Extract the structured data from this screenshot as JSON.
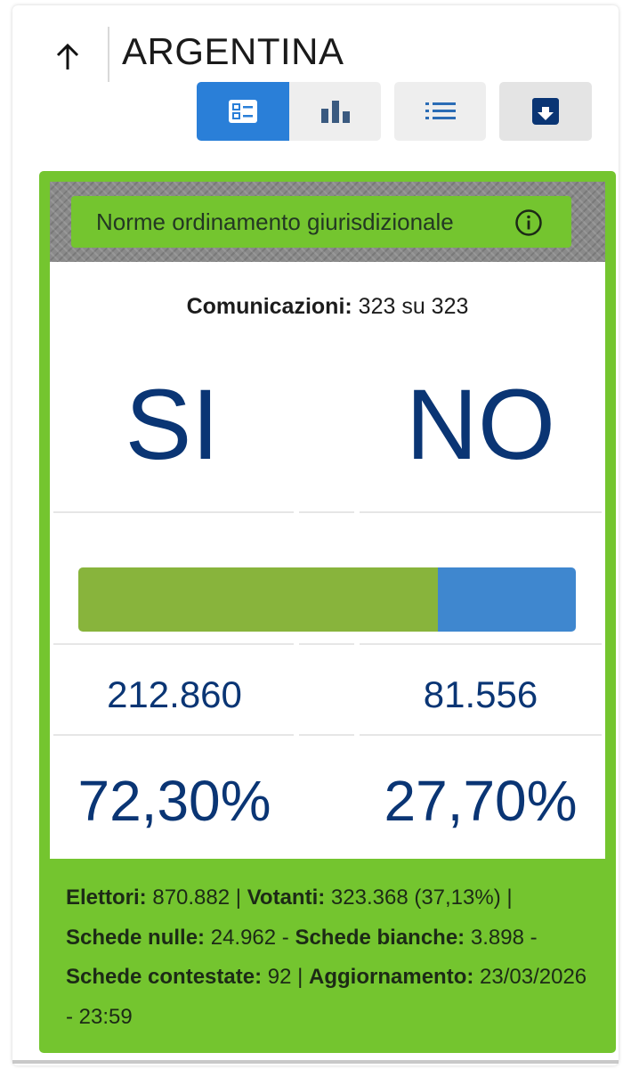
{
  "header": {
    "title": "ARGENTINA"
  },
  "view_buttons": [
    {
      "icon": "detail-view-icon",
      "active": true
    },
    {
      "icon": "bar-chart-icon",
      "active": false
    },
    {
      "icon": "list-icon",
      "active": false
    },
    {
      "icon": "download-icon",
      "active": false
    }
  ],
  "referendum": {
    "question": "Norme ordinamento giurisdizionale",
    "comunicazioni_label": "Comunicazioni:",
    "comunicazioni_value": "323 su 323",
    "si_label": "SI",
    "no_label": "NO",
    "si_votes": "212.860",
    "no_votes": "81.556",
    "si_pct": "72,30%",
    "no_pct": "27,70%",
    "si_share": 0.723
  },
  "footer": {
    "elettori_label": "Elettori:",
    "elettori_value": "870.882",
    "votanti_label": "Votanti:",
    "votanti_value": "323.368 (37,13%)",
    "nulle_label": "Schede nulle:",
    "nulle_value": "24.962",
    "bianche_label": "Schede bianche:",
    "bianche_value": "3.898",
    "contestate_label": "Schede contestate:",
    "contestate_value": "92",
    "aggiornamento_label": "Aggiornamento:",
    "aggiornamento_value": "23/03/2026 - 23:59"
  },
  "colors": {
    "card_green": "#74c52f",
    "si_bar": "#88b43c",
    "no_bar": "#3f87cf",
    "active_button": "#2a7fd8",
    "number_blue": "#0a3574"
  }
}
